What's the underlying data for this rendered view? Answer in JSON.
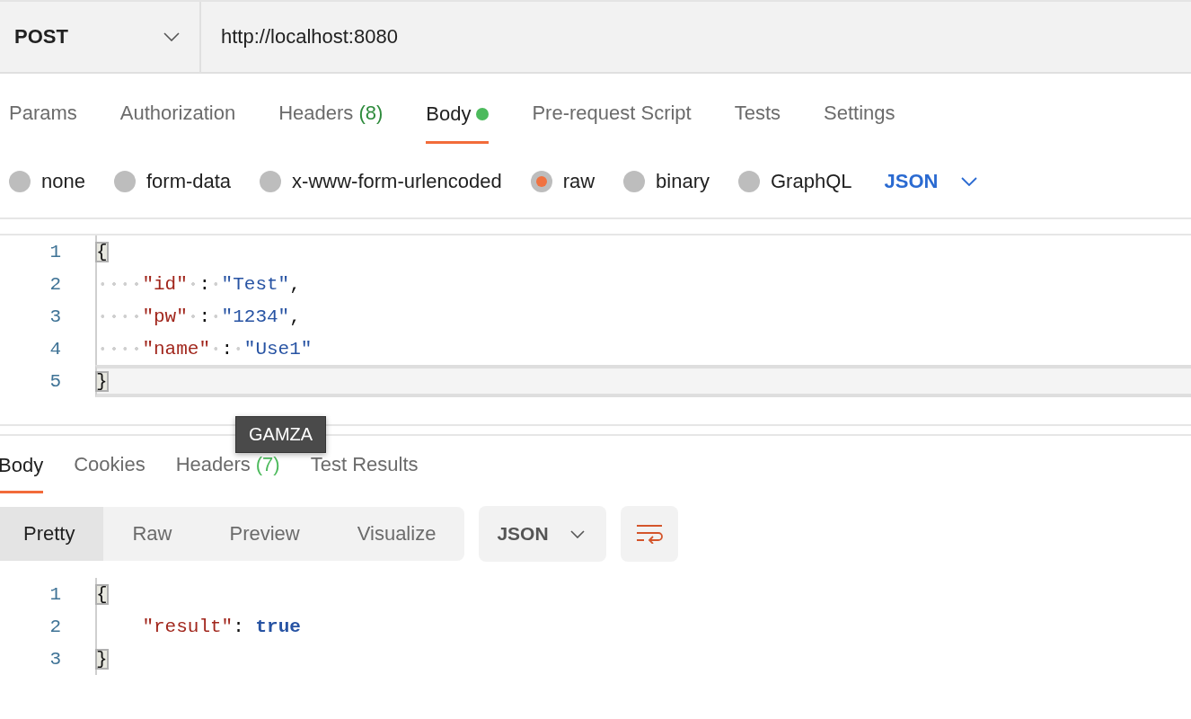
{
  "request_bar": {
    "method": "POST",
    "url": "http://localhost:8080"
  },
  "request_tabs": [
    {
      "label": "Params",
      "selected": false
    },
    {
      "label": "Authorization",
      "selected": false
    },
    {
      "label": "Headers",
      "count": "(8)",
      "selected": false
    },
    {
      "label": "Body",
      "selected": true,
      "dot": true
    },
    {
      "label": "Pre-request Script",
      "selected": false
    },
    {
      "label": "Tests",
      "selected": false
    },
    {
      "label": "Settings",
      "selected": false
    }
  ],
  "body_types": [
    {
      "label": "none",
      "selected": false
    },
    {
      "label": "form-data",
      "selected": false
    },
    {
      "label": "x-www-form-urlencoded",
      "selected": false
    },
    {
      "label": "raw",
      "selected": true
    },
    {
      "label": "binary",
      "selected": false
    },
    {
      "label": "GraphQL",
      "selected": false
    }
  ],
  "body_format": "JSON",
  "request_editor": {
    "lines": [
      {
        "number": "1",
        "active": false,
        "tokens": [
          {
            "kind": "bracket",
            "text": "{"
          }
        ]
      },
      {
        "number": "2",
        "active": false,
        "tokens": [
          {
            "kind": "dot"
          },
          {
            "kind": "dot"
          },
          {
            "kind": "dot"
          },
          {
            "kind": "dot"
          },
          {
            "kind": "key",
            "text": "\"id\""
          },
          {
            "kind": "dot"
          },
          {
            "kind": "punct",
            "text": ":"
          },
          {
            "kind": "dot"
          },
          {
            "kind": "string",
            "text": "\"Test\""
          },
          {
            "kind": "punct",
            "text": ","
          }
        ]
      },
      {
        "number": "3",
        "active": false,
        "tokens": [
          {
            "kind": "dot"
          },
          {
            "kind": "dot"
          },
          {
            "kind": "dot"
          },
          {
            "kind": "dot"
          },
          {
            "kind": "key",
            "text": "\"pw\""
          },
          {
            "kind": "dot"
          },
          {
            "kind": "punct",
            "text": ":"
          },
          {
            "kind": "dot"
          },
          {
            "kind": "string",
            "text": "\"1234\""
          },
          {
            "kind": "punct",
            "text": ","
          }
        ]
      },
      {
        "number": "4",
        "active": false,
        "tokens": [
          {
            "kind": "dot"
          },
          {
            "kind": "dot"
          },
          {
            "kind": "dot"
          },
          {
            "kind": "dot"
          },
          {
            "kind": "key",
            "text": "\"name\""
          },
          {
            "kind": "dot"
          },
          {
            "kind": "punct",
            "text": ":"
          },
          {
            "kind": "dot"
          },
          {
            "kind": "string",
            "text": "\"Use1\""
          }
        ]
      },
      {
        "number": "5",
        "active": true,
        "tokens": [
          {
            "kind": "bracket",
            "text": "}"
          }
        ]
      }
    ]
  },
  "tooltip": "GAMZA",
  "response_tabs": [
    {
      "label": "Body",
      "selected": true
    },
    {
      "label": "Cookies",
      "selected": false
    },
    {
      "label": "Headers",
      "count": "(7)",
      "selected": false
    },
    {
      "label": "Test Results",
      "selected": false
    }
  ],
  "view_modes": [
    {
      "label": "Pretty",
      "selected": true
    },
    {
      "label": "Raw",
      "selected": false
    },
    {
      "label": "Preview",
      "selected": false
    },
    {
      "label": "Visualize",
      "selected": false
    }
  ],
  "response_format": "JSON",
  "response_editor": {
    "lines": [
      {
        "number": "1",
        "tokens": [
          {
            "kind": "bracket",
            "text": "{"
          }
        ]
      },
      {
        "number": "2",
        "tokens": [
          {
            "kind": "indent"
          },
          {
            "kind": "key",
            "text": "\"result\""
          },
          {
            "kind": "punct",
            "text": ": "
          },
          {
            "kind": "literal",
            "text": "true"
          }
        ]
      },
      {
        "number": "3",
        "tokens": [
          {
            "kind": "bracket",
            "text": "}"
          }
        ]
      }
    ]
  }
}
